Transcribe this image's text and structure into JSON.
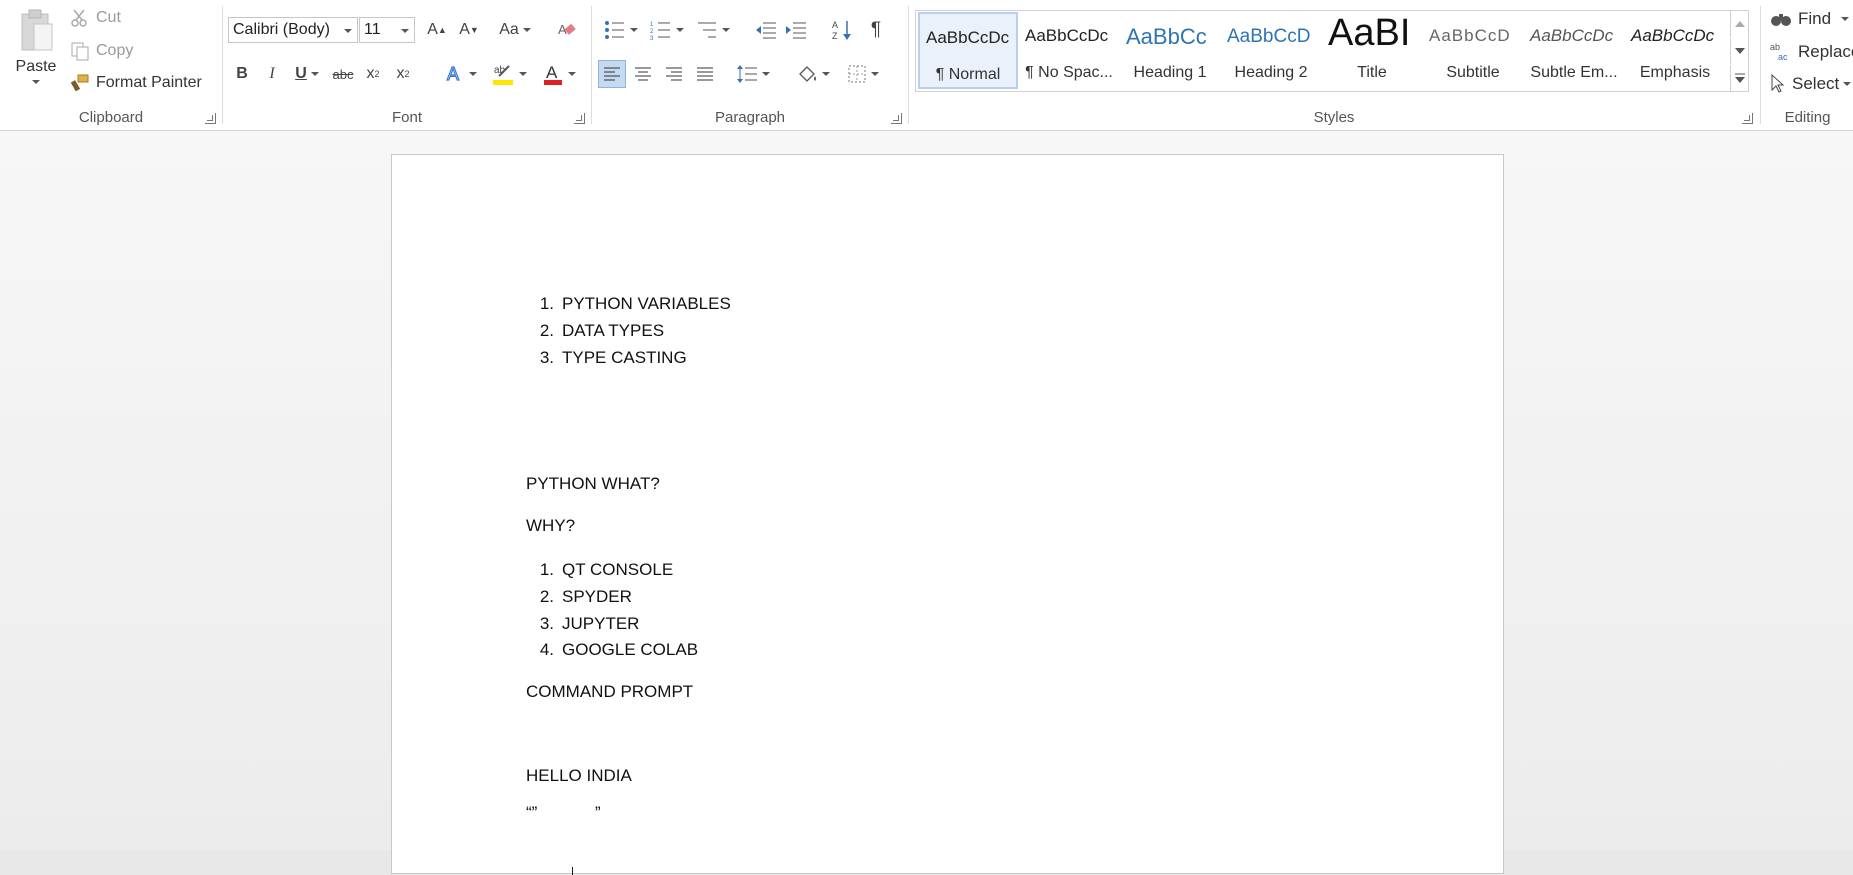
{
  "clipboard": {
    "paste": "Paste",
    "cut": "Cut",
    "copy": "Copy",
    "format_painter": "Format Painter",
    "label": "Clipboard"
  },
  "font": {
    "font_name": "Calibri (Body)",
    "font_size": "11",
    "grow": "A",
    "shrink": "A",
    "change_case": "Aa",
    "bold": "B",
    "italic": "I",
    "underline": "U",
    "strikethrough": "abc",
    "subscript": "x",
    "superscript": "x",
    "label": "Font"
  },
  "paragraph": {
    "show_marks": "¶",
    "label": "Paragraph"
  },
  "styles": {
    "label": "Styles",
    "items": [
      {
        "preview": "AaBbCcDc",
        "name": "¶ Normal"
      },
      {
        "preview": "AaBbCcDc",
        "name": "¶ No Spac..."
      },
      {
        "preview": "AaBbCc",
        "name": "Heading 1"
      },
      {
        "preview": "AaBbCcD",
        "name": "Heading 2"
      },
      {
        "preview": "AaBI",
        "name": "Title"
      },
      {
        "preview": "AaBbCcD",
        "name": "Subtitle"
      },
      {
        "preview": "AaBbCcDc",
        "name": "Subtle Em..."
      },
      {
        "preview": "AaBbCcDc",
        "name": "Emphasis"
      }
    ]
  },
  "editing": {
    "find": "Find",
    "replace": "Replace",
    "select": "Select",
    "label": "Editing"
  },
  "document": {
    "list1": [
      {
        "num": "1.",
        "text": "PYTHON VARIABLES"
      },
      {
        "num": "2.",
        "text": "DATA TYPES"
      },
      {
        "num": "3.",
        "text": "TYPE CASTING"
      }
    ],
    "para_python_what": "PYTHON WHAT?",
    "para_why": "WHY?",
    "list2": [
      {
        "num": "1.",
        "text": "QT CONSOLE"
      },
      {
        "num": "2.",
        "text": "SPYDER"
      },
      {
        "num": "3.",
        "text": "JUPYTER"
      },
      {
        "num": "4.",
        "text": "GOOGLE COLAB"
      }
    ],
    "para_command_prompt": "COMMAND PROMPT",
    "para_hello": "HELLO INDIA",
    "para_quotes_left": "“”",
    "para_quotes_right": "”"
  }
}
